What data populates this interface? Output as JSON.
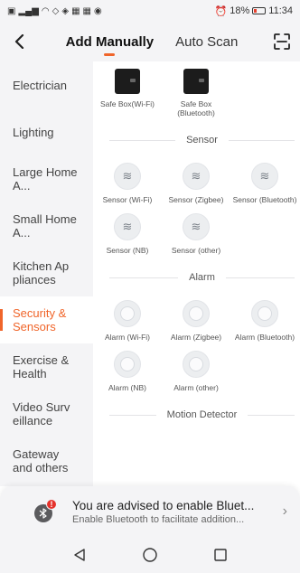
{
  "status_bar": {
    "left_icons": [
      "HD",
      "4G",
      "signal",
      "wifi",
      "vpn",
      "nfc",
      "app",
      "app",
      "camera"
    ],
    "battery": "18%",
    "time": "11:34"
  },
  "header": {
    "tabs": [
      {
        "label": "Add Manually",
        "active": true
      },
      {
        "label": "Auto Scan",
        "active": false
      }
    ],
    "accent": "#f0652a"
  },
  "sidebar": {
    "items": [
      {
        "label": "Electrician",
        "active": false
      },
      {
        "label": "Lighting",
        "active": false
      },
      {
        "label": "Large Home A...",
        "active": false
      },
      {
        "label": "Small Home A...",
        "active": false
      },
      {
        "label": "Kitchen Ap pliances",
        "active": false
      },
      {
        "label": "Security & Sensors",
        "active": true
      },
      {
        "label": "Exercise & Health",
        "active": false
      },
      {
        "label": "Video Surv eillance",
        "active": false
      },
      {
        "label": "Gateway and others",
        "active": false
      }
    ]
  },
  "content": {
    "safe_boxes": [
      {
        "label": "Safe Box(Wi-Fi)",
        "icon": "safe-box"
      },
      {
        "label": "Safe Box (Bluetooth)",
        "icon": "safe-box"
      }
    ],
    "sections": [
      {
        "title": "Sensor",
        "devices": [
          {
            "label": "Sensor (Wi-Fi)",
            "icon": "sensor"
          },
          {
            "label": "Sensor (Zigbee)",
            "icon": "sensor"
          },
          {
            "label": "Sensor (Bluetooth)",
            "icon": "sensor"
          },
          {
            "label": "Sensor (NB)",
            "icon": "sensor"
          },
          {
            "label": "Sensor (other)",
            "icon": "sensor"
          }
        ]
      },
      {
        "title": "Alarm",
        "devices": [
          {
            "label": "Alarm (Wi-Fi)",
            "icon": "alarm"
          },
          {
            "label": "Alarm (Zigbee)",
            "icon": "alarm"
          },
          {
            "label": "Alarm (Bluetooth)",
            "icon": "alarm"
          },
          {
            "label": "Alarm (NB)",
            "icon": "alarm"
          },
          {
            "label": "Alarm (other)",
            "icon": "alarm"
          }
        ]
      },
      {
        "title": "Motion Detector",
        "devices": []
      }
    ]
  },
  "banner": {
    "title": "You are advised to enable Bluet...",
    "subtitle": "Enable Bluetooth to facilitate addition...",
    "badge": "!"
  }
}
